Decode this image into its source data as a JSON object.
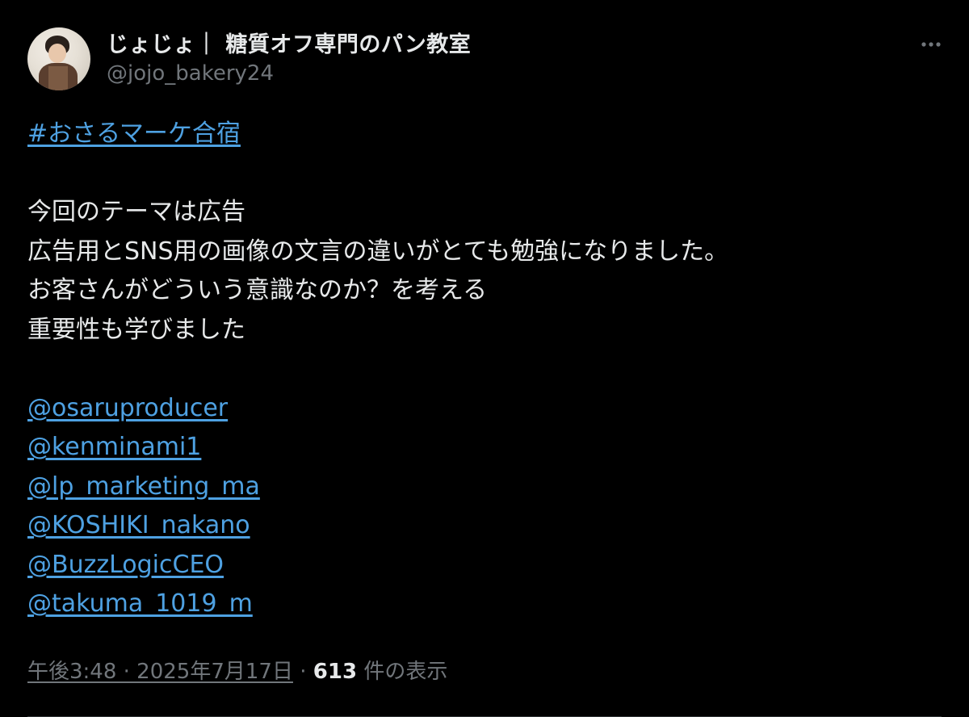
{
  "author": {
    "display_name": "じょじょ｜ 糖質オフ専門のパン教室",
    "handle": "@jojo_bakery24"
  },
  "body": {
    "hashtag": "#おさるマーケ合宿",
    "lines": [
      "今回のテーマは広告",
      "広告用とSNS用の画像の文言の違いがとても勉強になりました。",
      "お客さんがどういう意識なのか？を考える",
      "重要性も学びました"
    ],
    "mentions": [
      "@osaruproducer",
      "@kenminami1",
      "@lp_marketing_ma",
      "@KOSHIKI_nakano",
      "@BuzzLogicCEO",
      "@takuma_1019_m"
    ]
  },
  "meta": {
    "timestamp": "午後3:48 · 2025年7月17日",
    "separator": " · ",
    "views_count": "613",
    "views_label": " 件の表示"
  },
  "icons": {
    "more": "more-horizontal-icon"
  },
  "colors": {
    "background": "#000000",
    "text": "#e7e9ea",
    "secondary": "#71767b",
    "link": "#4ea1e2"
  }
}
